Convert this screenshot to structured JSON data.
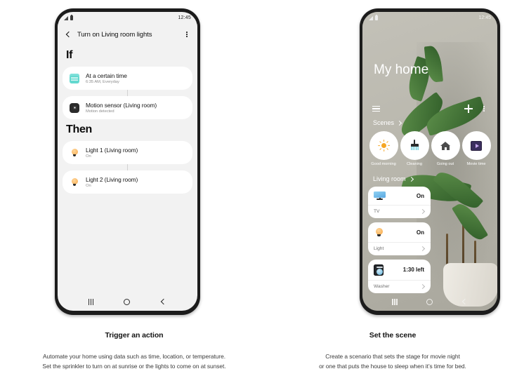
{
  "phone_automation": {
    "status_bar": {
      "signal_icon": "signal-bars-icon",
      "battery_icon": "battery-icon",
      "time": "12:45"
    },
    "app_bar": {
      "back_icon": "chevron-left-icon",
      "title": "Turn on Living room lights",
      "menu_icon": "kebab-menu-icon"
    },
    "if_section": {
      "heading": "If",
      "items": [
        {
          "icon": "calendar-icon",
          "primary": "At a certain time",
          "secondary": "6:35 AM, Everyday"
        },
        {
          "icon": "motion-sensor-icon",
          "primary": "Motion sensor (Living room)",
          "secondary": "Motion detected"
        }
      ]
    },
    "then_section": {
      "heading": "Then",
      "items": [
        {
          "icon": "light-bulb-icon",
          "primary": "Light 1 (Living room)",
          "secondary": "On"
        },
        {
          "icon": "light-bulb-icon",
          "primary": "Light 2 (Living room)",
          "secondary": "On"
        }
      ]
    },
    "nav_bar": {
      "recents_icon": "recents-icon",
      "home_icon": "home-icon",
      "back_icon": "back-icon"
    }
  },
  "phone_smartthings": {
    "status_bar": {
      "signal_icon": "signal-bars-icon",
      "battery_icon": "battery-icon",
      "time": "12:45"
    },
    "home_title": "My home",
    "toolbar": {
      "menu_icon": "hamburger-menu-icon",
      "add_icon": "plus-icon",
      "more_icon": "kebab-menu-icon"
    },
    "scenes_section": {
      "label": "Scenes",
      "chevron_icon": "chevron-right-icon",
      "items": [
        {
          "icon": "sun-icon",
          "label": "Good morning"
        },
        {
          "icon": "broom-icon",
          "label": "Cleaning"
        },
        {
          "icon": "house-icon",
          "label": "Going out"
        },
        {
          "icon": "movie-icon",
          "label": "Movie time"
        }
      ]
    },
    "living_room_section": {
      "label": "Living room",
      "chevron_icon": "chevron-right-icon",
      "devices": [
        {
          "icon": "tv-icon",
          "state": "On",
          "name": "TV",
          "chevron_icon": "chevron-right-icon"
        },
        {
          "icon": "bulb-icon",
          "state": "On",
          "name": "Light",
          "chevron_icon": "chevron-right-icon"
        },
        {
          "icon": "washer-icon",
          "state": "1:30 left",
          "name": "Washer",
          "chevron_icon": "chevron-right-icon"
        }
      ]
    },
    "nav_bar": {
      "recents_icon": "recents-icon",
      "home_icon": "home-icon",
      "back_icon": "back-icon"
    }
  },
  "captions": {
    "left": {
      "title": "Trigger an action",
      "line1": "Automate your home using data such as time, location, or temperature.",
      "line2": "Set the sprinkler to turn on at sunrise or the lights to come on at sunset."
    },
    "right": {
      "title": "Set the scene",
      "line1": "Create a scenario that sets the stage for movie night",
      "line2": "or one that puts the house to sleep when it’s time for bed."
    }
  },
  "colors": {
    "page_background": "#ffffff",
    "phone_frame": "#1c1c1c",
    "automation_screen_bg": "#f2f2f2",
    "card_bg": "#ffffff",
    "calendar_icon": "#63d8cf",
    "bulb_icon": "#f7a94e",
    "smartthings_wall": "#b8b6ae",
    "leaf_green": "#3d6e31"
  }
}
